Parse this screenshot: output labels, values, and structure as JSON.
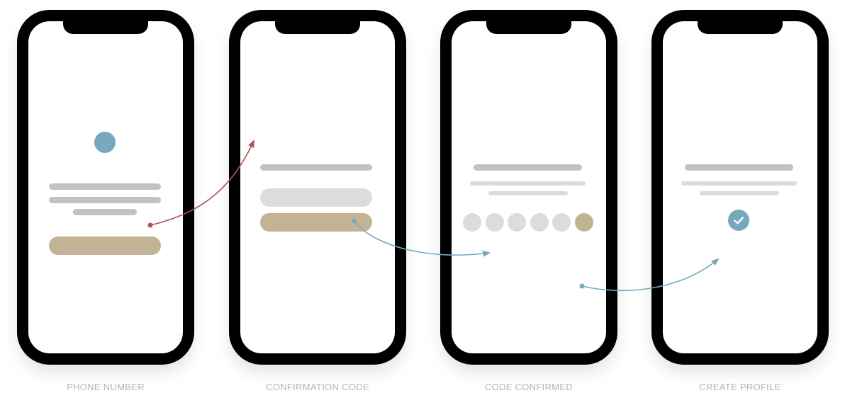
{
  "screens": [
    {
      "caption": "PHONE NUMBER"
    },
    {
      "caption": "CONFIRMATION CODE"
    },
    {
      "caption": "CODE CONFIRMED"
    },
    {
      "caption": "CREATE PROFILE"
    }
  ],
  "colors": {
    "accent_blue": "#76a9bd",
    "accent_tan": "#c2b394",
    "arrow_red": "#a85656",
    "placeholder_dark": "#c2c2c2",
    "placeholder_light": "#dcdcdc",
    "caption": "#b4b4b4"
  },
  "code_entry": {
    "total_digits": 6,
    "highlighted_digit": 6
  },
  "icons": {
    "status": "checkmark-icon",
    "avatar": "avatar-placeholder-icon"
  }
}
